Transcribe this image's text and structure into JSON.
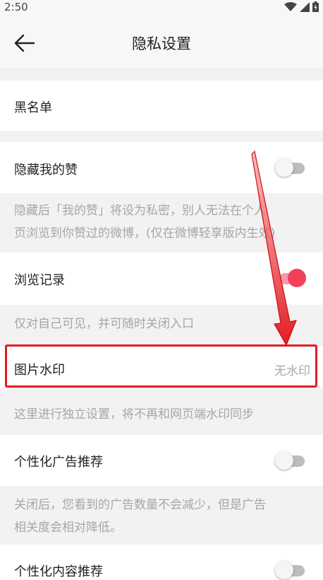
{
  "status_bar": {
    "time": "2:50"
  },
  "header": {
    "title": "隐私设置"
  },
  "blacklist": {
    "label": "黑名单"
  },
  "hide_likes": {
    "label": "隐藏我的赞",
    "enabled": false,
    "note_line1": "隐藏后「我的赞」将设为私密，别人无法在个人",
    "note_line2": "页浏览到你赞过的微博，(仅在微博轻享版内生效)"
  },
  "browse_history": {
    "label": "浏览记录",
    "enabled": true,
    "note": "仅对自己可见，并可随时关闭入口"
  },
  "image_watermark": {
    "label": "图片水印",
    "value": "无水印",
    "note": "这里进行独立设置，将不再和网页端水印同步"
  },
  "personalized_ads": {
    "label": "个性化广告推荐",
    "enabled": false,
    "note_line1": "关闭后，您看到的广告数量不会减少，但是广告",
    "note_line2": "相关度会相对降低。"
  },
  "personalized_content": {
    "label": "个性化内容推荐",
    "enabled": false
  },
  "colors": {
    "accent": "#f0405a",
    "annotation_red": "#e21b23"
  }
}
